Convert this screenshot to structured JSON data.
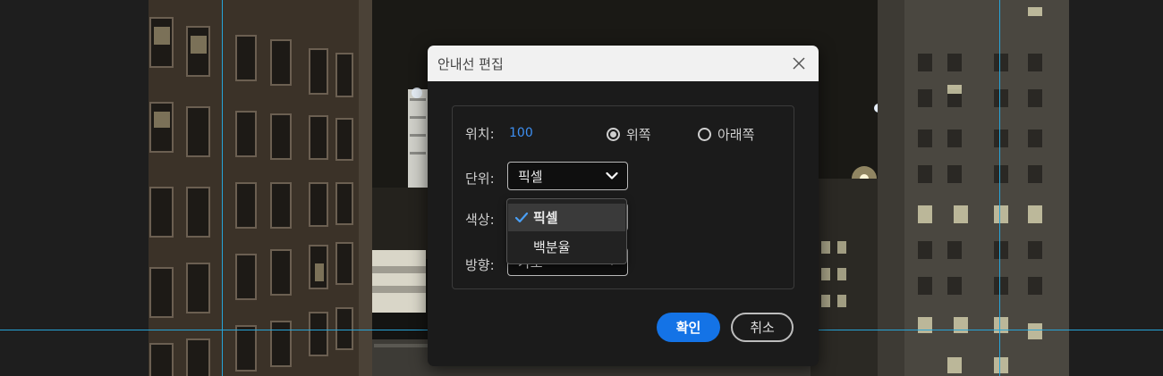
{
  "dialog": {
    "title": "안내선 편집",
    "position": {
      "label": "위치:",
      "value": "100",
      "options": [
        {
          "label": "위쪽",
          "selected": true
        },
        {
          "label": "아래쪽",
          "selected": false
        }
      ]
    },
    "unit": {
      "label": "단위:",
      "selected": "픽셀",
      "menu_items": [
        {
          "label": "픽셀",
          "checked": true
        },
        {
          "label": "백분율",
          "checked": false
        }
      ]
    },
    "color": {
      "label": "색상:"
    },
    "direction": {
      "label": "방향:",
      "partial_value": "가로"
    },
    "ok_label": "확인",
    "cancel_label": "취소"
  },
  "icons": {
    "close": "close-icon",
    "chevron": "chevron-down-icon",
    "check": "checkmark-icon"
  },
  "colors": {
    "accent": "#1473e6",
    "guide_line": "#26a4d8",
    "value_text": "#3d8ff2",
    "dialog_bg": "#1b1b1b",
    "header_bg": "#f1f1f1"
  }
}
